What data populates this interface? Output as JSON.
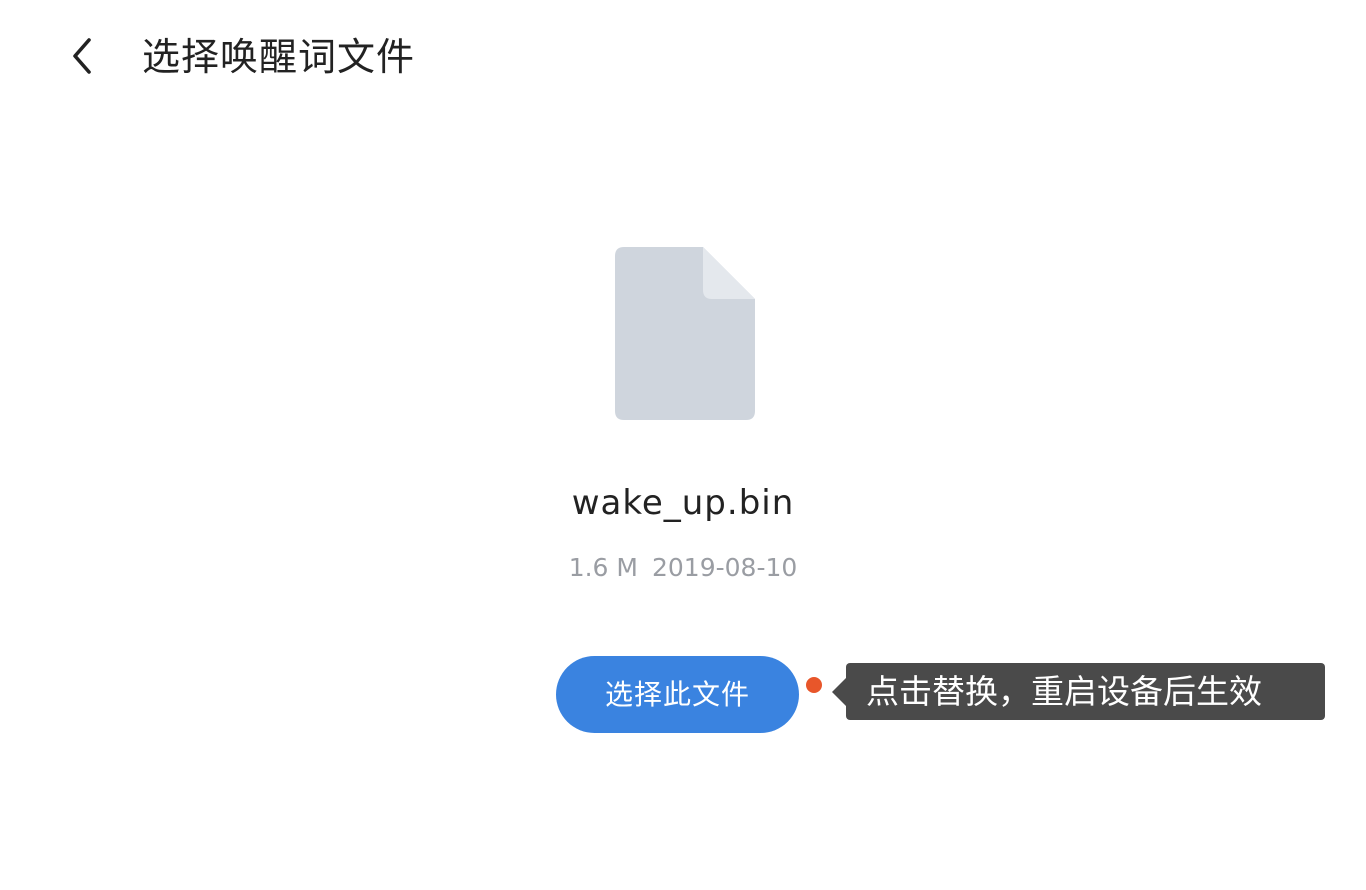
{
  "header": {
    "back_icon": "chevron-left-icon",
    "title": "选择唤醒词文件"
  },
  "file": {
    "icon": "document-icon",
    "name": "wake_up.bin",
    "size": "1.6 M",
    "date": "2019-08-10"
  },
  "actions": {
    "select_label": "选择此文件"
  },
  "tooltip": {
    "text": "点击替换，重启设备后生效"
  },
  "colors": {
    "primary": "#3a83e0",
    "tooltip_bg": "#4a4a4a",
    "indicator_dot": "#e8562a",
    "file_icon": "#cfd5dd",
    "file_icon_fold": "#e4e8ed",
    "meta_text": "#9a9da3"
  }
}
